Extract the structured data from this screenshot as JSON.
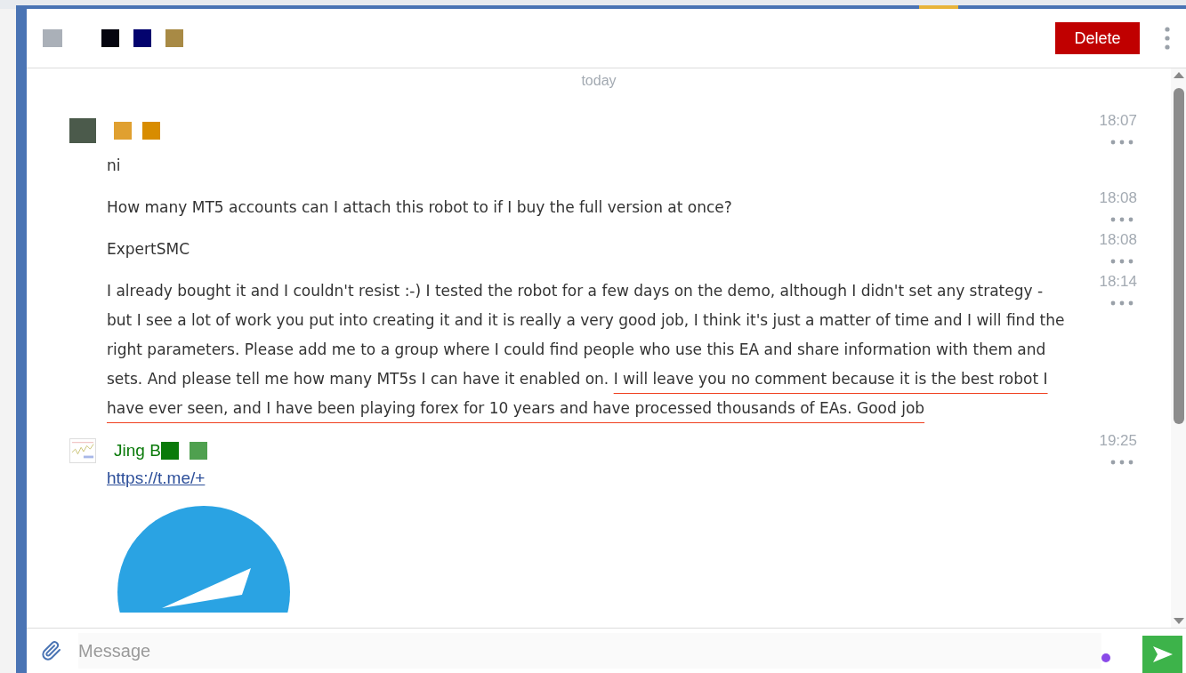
{
  "header": {
    "blocks": [
      {
        "color": "#aab0b8"
      },
      {
        "color": "#05050f"
      },
      {
        "color": "#03036e"
      },
      {
        "color": "#a88a45"
      }
    ],
    "delete_button": "Delete"
  },
  "date_divider": "today",
  "messages": [
    {
      "kind": "author",
      "avatar": {
        "kind": "photo"
      },
      "author_blocks": [
        {
          "color": "#e0a030"
        },
        {
          "color": "#d88c00"
        }
      ],
      "time": "18:07"
    },
    {
      "kind": "text",
      "text": "ni"
    },
    {
      "kind": "text",
      "text": "How many MT5 accounts can I attach this robot to if I buy the full version at once?",
      "time": "18:08"
    },
    {
      "kind": "text",
      "text": "ExpertSMC",
      "time": "18:08"
    },
    {
      "kind": "text",
      "text": "I already bought it and I couldn't resist :-) I tested the robot for a few days on the demo, although I didn't set any strategy - but I see a lot of work you put into creating it and it is really a very good job, I think it's just a matter of time and I will find the right parameters. Please add me to a group where I could find people who use this EA and share information with them and sets. And please tell me how many MT5s I can have it enabled on. ",
      "highlighted": "I will leave you no comment because it is the best robot I have ever seen, and I have been playing forex for 10 years and have processed thousands of EAs. Good job",
      "time": "18:14"
    },
    {
      "kind": "author",
      "avatar": {
        "kind": "chart"
      },
      "author": "Jing B",
      "author_blocks": [
        {
          "color": "#0a7a0a"
        },
        {
          "color": "#4fa04f"
        }
      ],
      "time": "19:25"
    },
    {
      "kind": "link",
      "text": "https://t.me/+"
    },
    {
      "kind": "image"
    }
  ],
  "composer": {
    "placeholder": "Message"
  }
}
